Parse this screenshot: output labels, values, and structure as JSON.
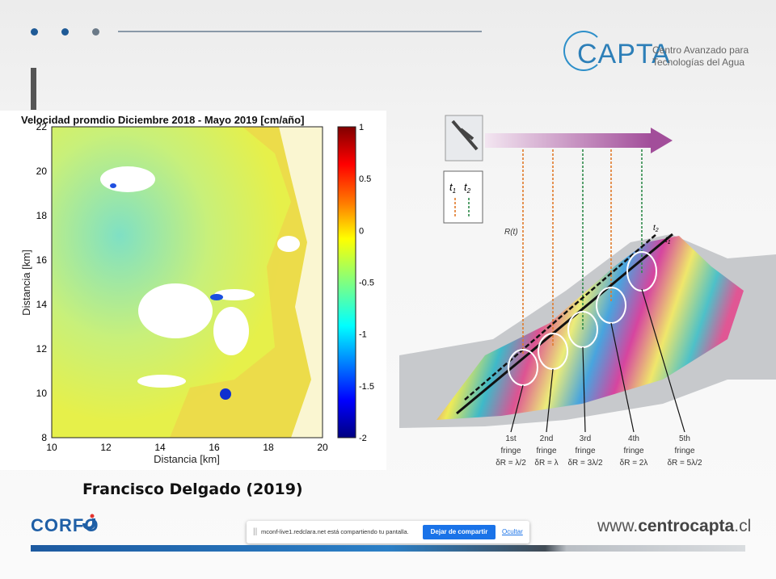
{
  "slide": {
    "dots_color": "#1e5a96",
    "author": "Francisco Delgado (2019)",
    "website_prefix": "www.",
    "website_bold": "centrocapta",
    "website_suffix": ".cl",
    "corfo_logo": "CORFO"
  },
  "capta_logo": {
    "word": "CAPTA",
    "line1": "Centro Avanzado para",
    "line2": "Tecnologías del Agua"
  },
  "velocity_map": {
    "title": "Velocidad promdio Diciembre 2018 - Mayo 2019 [cm/año]",
    "xlabel": "Distancia [km]",
    "ylabel": "Distancia [km]",
    "x_ticks": [
      "10",
      "12",
      "14",
      "16",
      "18",
      "20"
    ],
    "y_ticks": [
      "22",
      "20",
      "18",
      "16",
      "14",
      "12",
      "10",
      "8"
    ],
    "colorbar_ticks": [
      "1",
      "0.5",
      "0",
      "-0.5",
      "-1",
      "-1.5",
      "-2"
    ]
  },
  "insar_diagram": {
    "legend_t1": "t",
    "legend_t1_sub": "1",
    "legend_t2": "t",
    "legend_t2_sub": "2",
    "range_label": "R(t)",
    "fringes": [
      {
        "name": "1st",
        "word": "fringe",
        "delta": "δR = λ/2"
      },
      {
        "name": "2nd",
        "word": "fringe",
        "delta": "δR = λ"
      },
      {
        "name": "3rd",
        "word": "fringe",
        "delta": "δR = 3λ/2"
      },
      {
        "name": "4th",
        "word": "fringe",
        "delta": "δR = 2λ"
      },
      {
        "name": "5th",
        "word": "fringe",
        "delta": "δR = 5λ/2"
      }
    ]
  },
  "share_bar": {
    "grip": "||",
    "message": "mconf-live1.redclara.net está compartiendo tu pantalla.",
    "stop_button": "Dejar de compartir",
    "hide_link": "Ocultar"
  }
}
